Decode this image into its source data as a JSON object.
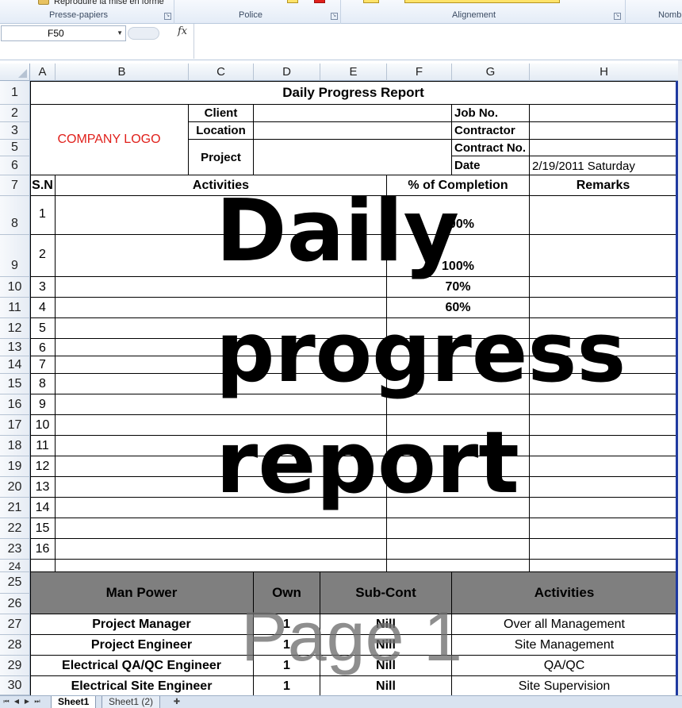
{
  "ribbon": {
    "clipboard_item": "Reproduire la mise en forme",
    "groups": [
      "Presse-papiers",
      "Police",
      "Alignement",
      "Nomb"
    ]
  },
  "formula_bar": {
    "name_box": "F50",
    "fx": "fx",
    "value": ""
  },
  "columns": [
    "A",
    "B",
    "C",
    "D",
    "E",
    "F",
    "G",
    "H"
  ],
  "rows": [
    "1",
    "2",
    "3",
    "5",
    "6",
    "7",
    "8",
    "9",
    "10",
    "11",
    "12",
    "13",
    "14",
    "15",
    "16",
    "17",
    "18",
    "19",
    "20",
    "21",
    "22",
    "23",
    "24",
    "25",
    "26",
    "27",
    "28",
    "29",
    "30"
  ],
  "report": {
    "title": "Daily Progress Report",
    "logo": "COMPANY LOGO",
    "client_label": "Client",
    "location_label": "Location",
    "project_label": "Project",
    "job_label": "Job No.",
    "contractor_label": "Contractor",
    "contract_label": "Contract No.",
    "date_label": "Date",
    "date_value": "2/19/2011 Saturday",
    "headers": {
      "sn": "S.N",
      "activities": "Activities",
      "completion": "% of Completion",
      "remarks": "Remarks"
    },
    "items": [
      {
        "sn": "1",
        "completion": "100%"
      },
      {
        "sn": "2",
        "completion": "100%"
      },
      {
        "sn": "3",
        "completion": "70%"
      },
      {
        "sn": "4",
        "completion": "60%"
      },
      {
        "sn": "5",
        "completion": ""
      },
      {
        "sn": "6",
        "completion": ""
      },
      {
        "sn": "7",
        "completion": ""
      },
      {
        "sn": "8",
        "completion": ""
      },
      {
        "sn": "9",
        "completion": ""
      },
      {
        "sn": "10",
        "completion": ""
      },
      {
        "sn": "11",
        "completion": ""
      },
      {
        "sn": "12",
        "completion": ""
      },
      {
        "sn": "13",
        "completion": ""
      },
      {
        "sn": "14",
        "completion": ""
      },
      {
        "sn": "15",
        "completion": ""
      },
      {
        "sn": "16",
        "completion": ""
      }
    ],
    "manpower_headers": {
      "man_power": "Man Power",
      "own": "Own",
      "sub_cont": "Sub-Cont",
      "activities": "Activities"
    },
    "manpower": [
      {
        "role": "Project Manager",
        "own": "1",
        "sub": "Nill",
        "activity": "Over all Management"
      },
      {
        "role": "Project Engineer",
        "own": "1",
        "sub": "Nill",
        "activity": "Site Management"
      },
      {
        "role": "Electrical QA/QC Engineer",
        "own": "1",
        "sub": "Nill",
        "activity": "QA/QC"
      },
      {
        "role": "Electrical Site Engineer",
        "own": "1",
        "sub": "Nill",
        "activity": "Site Supervision"
      }
    ]
  },
  "watermark": {
    "line1": "Daily",
    "line2": "progress",
    "line3": "report"
  },
  "page_mark": "Page 1",
  "sheet_tabs": [
    "Sheet1",
    "Sheet1 (2)"
  ],
  "colors": {
    "logo": "#e0201b",
    "header_fill": "#7f7f7f",
    "border_accent": "#1f3aa0"
  }
}
